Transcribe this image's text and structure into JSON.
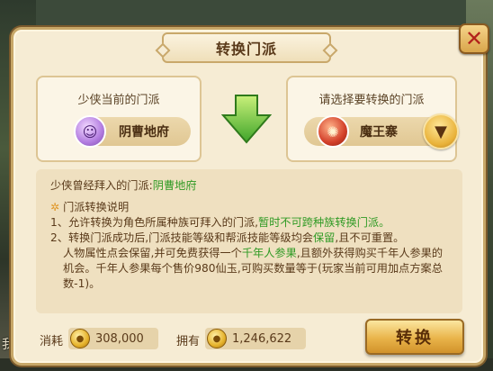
{
  "background": {
    "text": "我"
  },
  "dialog": {
    "title": "转换门派",
    "close_icon": "close-icon"
  },
  "current_sect": {
    "label": "少侠当前的门派",
    "name": "阴曹地府",
    "icon": "ghost-sect-icon"
  },
  "target_sect": {
    "label": "请选择要转换的门派",
    "name": "魔王寨",
    "icon": "demon-sect-icon",
    "dropdown_icon": "chevron-down-icon"
  },
  "arrow_icon": "green-arrow-down-icon",
  "info": {
    "prev_label": "少侠曾经拜入的门派:",
    "prev_value": "阴曹地府",
    "section_title": "门派转换说明",
    "rule1_a": "1、允许转换为角色所属种族可拜入的门派,",
    "rule1_b": "暂时不可跨种族转换门派。",
    "rule2_a": "2、转换门派成功后,门派技能等级和帮派技能等级均会",
    "rule2_b": "保留",
    "rule2_c": ",且不可重置。",
    "rule3_a": "人物属性点会保留,并可免费获得一个",
    "rule3_b": "千年人参果",
    "rule3_c": ",且额外获得购买千年人参果的机会。千年人参果每个售价980仙玉,可购买数量等于(玩家当前可用加点方案总数-1)。"
  },
  "footer": {
    "cost_label": "消耗",
    "cost_value": "308,000",
    "own_label": "拥有",
    "own_value": "1,246,622",
    "coin_icon": "coin-icon",
    "convert_button": "转换"
  },
  "colors": {
    "accent_green": "#2f9a24",
    "panel_bg": "#f6ecd4",
    "frame": "#c7a768"
  }
}
